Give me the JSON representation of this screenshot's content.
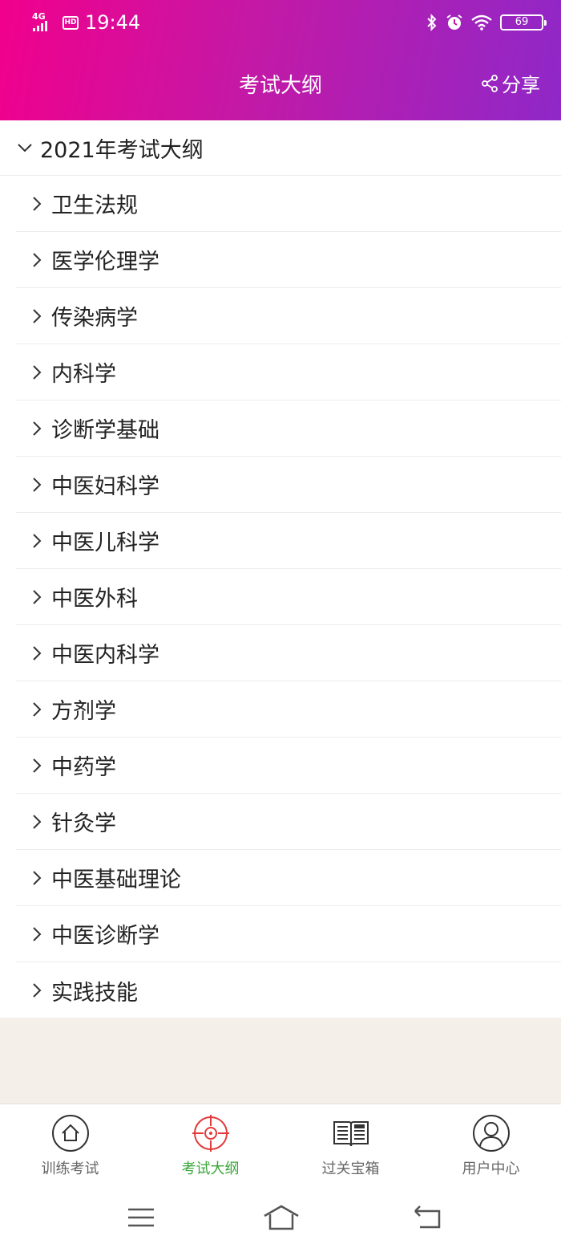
{
  "status": {
    "network": "4G",
    "hd": "HD",
    "time": "19:44",
    "battery": "69"
  },
  "header": {
    "title": "考试大纲",
    "share_label": "分享"
  },
  "outline": {
    "group_title": "2021年考试大纲",
    "items": [
      "卫生法规",
      "医学伦理学",
      "传染病学",
      "内科学",
      "诊断学基础",
      "中医妇科学",
      "中医儿科学",
      "中医外科",
      "中医内科学",
      "方剂学",
      "中药学",
      "针灸学",
      "中医基础理论",
      "中医诊断学",
      "实践技能"
    ]
  },
  "bottom_nav": {
    "items": [
      {
        "label": "训练考试",
        "icon": "home-icon"
      },
      {
        "label": "考试大纲",
        "icon": "target-icon",
        "active": true
      },
      {
        "label": "过关宝箱",
        "icon": "book-icon"
      },
      {
        "label": "用户中心",
        "icon": "user-icon"
      }
    ]
  },
  "colors": {
    "header_gradient_start": "#f1008c",
    "header_gradient_end": "#8f28c8",
    "active_tab_label": "#3aa63a",
    "active_tab_icon": "#e23a3a"
  }
}
